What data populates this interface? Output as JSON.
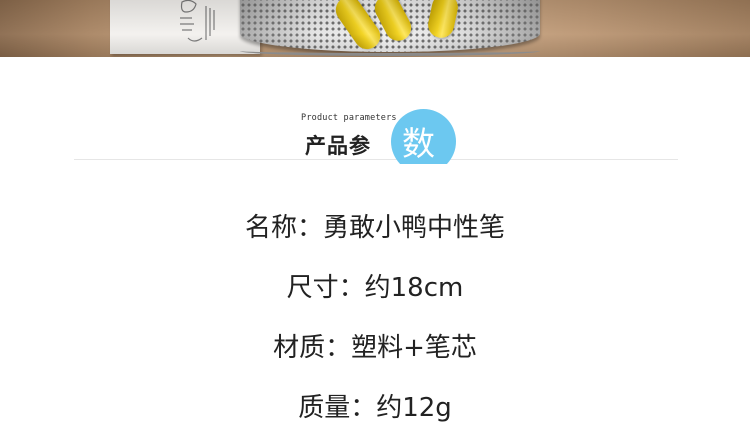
{
  "header": {
    "subtitle_en": "Product parameters",
    "title_zh_prefix": "产品参",
    "title_zh_highlight": "数",
    "highlight_color": "#6cc8f0"
  },
  "params": [
    {
      "text": "名称：勇敢小鸭中性笔"
    },
    {
      "text": "尺寸：约18cm"
    },
    {
      "text": "材质：塑料+笔芯"
    },
    {
      "text": "质量：约12g"
    }
  ]
}
